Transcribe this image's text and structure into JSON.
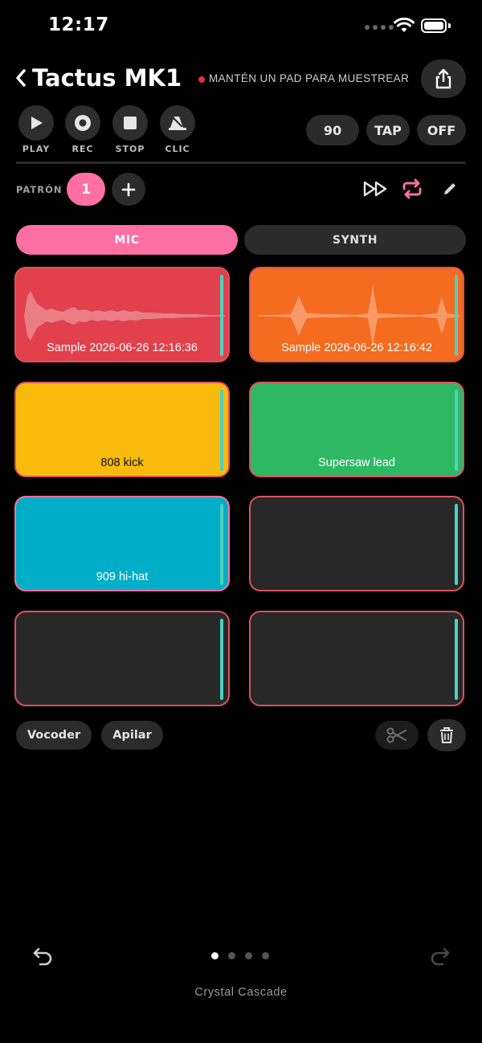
{
  "status_bar": {
    "time": "12:17"
  },
  "header": {
    "title": "Tactus MK1",
    "hint": "MANTÉN UN PAD PARA MUESTREAR"
  },
  "transport": {
    "play_label": "PLAY",
    "rec_label": "REC",
    "stop_label": "STOP",
    "click_label": "CLIC",
    "bpm": "90",
    "tap_label": "TAP",
    "off_label": "OFF"
  },
  "pattern": {
    "label": "PATRÓN",
    "current": "1"
  },
  "tabs": {
    "mic": "MIC",
    "synth": "SYNTH"
  },
  "pads": [
    {
      "label": "Sample 2026-06-26 12:16:36",
      "color": "#e1404c"
    },
    {
      "label": "Sample 2026-06-26 12:16:42",
      "color": "#f56b1f"
    },
    {
      "label": "808 kick",
      "color": "#f9bb0b"
    },
    {
      "label": "Supersaw lead",
      "color": "#2fb864"
    },
    {
      "label": "909 hi-hat",
      "color": "#00aec8"
    },
    {
      "label": "",
      "color": "#282828"
    },
    {
      "label": "",
      "color": "#282828"
    },
    {
      "label": "",
      "color": "#282828"
    }
  ],
  "actions": {
    "vocoder": "Vocoder",
    "stack": "Apilar"
  },
  "footer": {
    "name": "Crystal Cascade",
    "page_current": 1,
    "page_count": 4
  },
  "colors": {
    "accent": "#ff6fa3",
    "pad_border": "#d9545c",
    "level_bar": "#4fd0c0"
  }
}
